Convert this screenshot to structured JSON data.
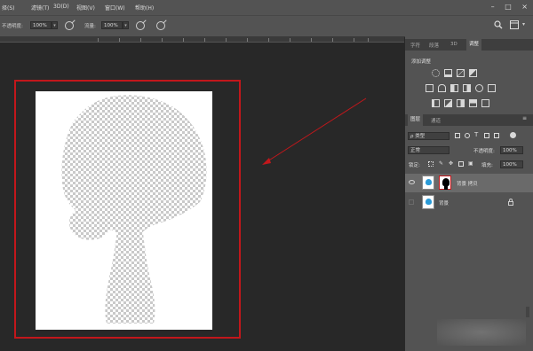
{
  "menubar": {
    "items": [
      "择(S)",
      "滤镜(T)",
      "3D(D)",
      "视图(V)",
      "窗口(W)",
      "帮助(H)"
    ],
    "window_controls": [
      "–",
      "□",
      "×"
    ]
  },
  "options": {
    "opacity_label": "不透明度:",
    "opacity_value": "100%",
    "flow_label": "流量:",
    "flow_value": "100%"
  },
  "panels": {
    "top_tabs": [
      "字符",
      "段落",
      "3D",
      "调整"
    ],
    "adjust_title": "添加调整",
    "layer_tabs": [
      "图层",
      "通道"
    ],
    "kind_filter": "ρ 类型",
    "blend_mode": "正常",
    "opacity_label": "不透明度:",
    "opacity_value": "100%",
    "lock_label": "锁定:",
    "fill_label": "填充:",
    "fill_value": "100%",
    "layers": [
      {
        "name": "背景 拷贝",
        "selected": true,
        "has_mask": true
      },
      {
        "name": "背景",
        "selected": false,
        "has_mask": false,
        "locked": true
      }
    ]
  },
  "colors": {
    "annotation_red": "#c2171b",
    "ui_dark": "#282828",
    "panel": "#535353"
  },
  "icons": [
    "search-icon",
    "workspace-icon",
    "brush-pressure-icon",
    "eye-icon",
    "lock-icon"
  ]
}
